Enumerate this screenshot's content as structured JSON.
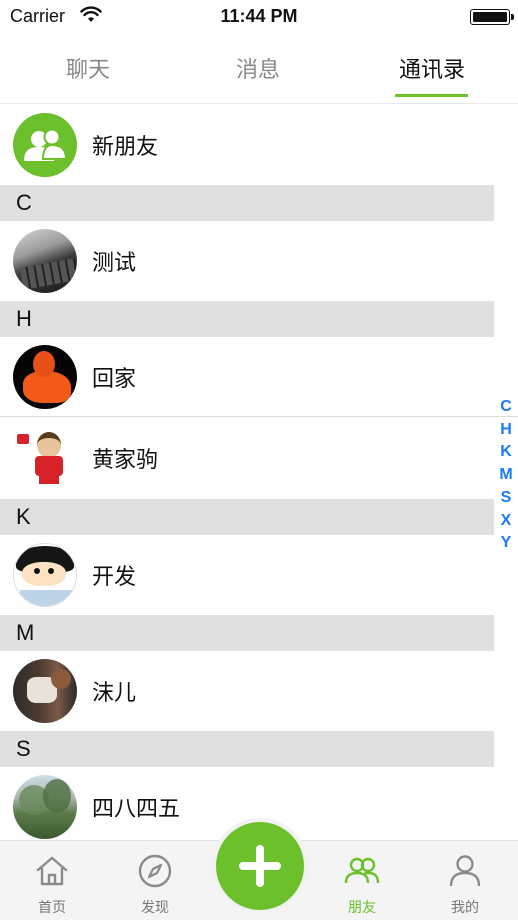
{
  "status": {
    "carrier": "Carrier",
    "time": "11:44 PM"
  },
  "tabs": [
    {
      "label": "聊天",
      "active": false
    },
    {
      "label": "消息",
      "active": false
    },
    {
      "label": "通讯录",
      "active": true
    }
  ],
  "new_friends": {
    "label": "新朋友",
    "icon": "people-icon",
    "color": "#6bc02c"
  },
  "sections": [
    {
      "letter": "C",
      "contacts": [
        {
          "name": "测试",
          "avatar": "keyboard-photo"
        }
      ]
    },
    {
      "letter": "H",
      "contacts": [
        {
          "name": "回家",
          "avatar": "orange-figure-photo"
        },
        {
          "name": "黄家驹",
          "avatar": "cartoon-player-photo"
        }
      ]
    },
    {
      "letter": "K",
      "contacts": [
        {
          "name": "开发",
          "avatar": "cartoon-boy-photo"
        }
      ]
    },
    {
      "letter": "M",
      "contacts": [
        {
          "name": "沫儿",
          "avatar": "person-photo"
        }
      ]
    },
    {
      "letter": "S",
      "contacts": [
        {
          "name": "四八四五",
          "avatar": "tree-photo"
        }
      ]
    }
  ],
  "index_letters": [
    "C",
    "H",
    "K",
    "M",
    "S",
    "X",
    "Y"
  ],
  "bottom_nav": [
    {
      "label": "首页",
      "icon": "home-icon",
      "active": false
    },
    {
      "label": "发现",
      "icon": "compass-icon",
      "active": false
    },
    {
      "label": "朋友",
      "icon": "friends-icon",
      "active": true
    },
    {
      "label": "我的",
      "icon": "user-icon",
      "active": false
    }
  ],
  "fab": {
    "icon": "plus-icon"
  },
  "colors": {
    "accent": "#6bc02c",
    "index": "#1a7cf5",
    "section_bg": "#e0e0e0"
  }
}
